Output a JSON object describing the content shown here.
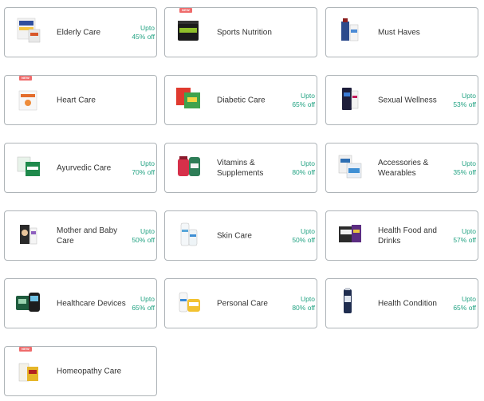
{
  "categories": [
    {
      "name": "Elderly Care",
      "discount": [
        "Upto",
        "45% off"
      ]
    },
    {
      "name": "Sports Nutrition",
      "discount": null,
      "new_badge": "NEW"
    },
    {
      "name": "Must Haves",
      "discount": null
    },
    {
      "name": "Heart Care",
      "discount": null,
      "new_badge": "NEW"
    },
    {
      "name": "Diabetic Care",
      "discount": [
        "Upto",
        "65% off"
      ]
    },
    {
      "name": "Sexual Wellness",
      "discount": [
        "Upto",
        "53% off"
      ]
    },
    {
      "name": "Ayurvedic Care",
      "discount": [
        "Upto",
        "70% off"
      ]
    },
    {
      "name": "Vitamins & Supplements",
      "discount": [
        "Upto",
        "80% off"
      ]
    },
    {
      "name": "Accessories & Wearables",
      "discount": [
        "Upto",
        "35% off"
      ]
    },
    {
      "name": "Mother and Baby Care",
      "discount": [
        "Upto",
        "50% off"
      ]
    },
    {
      "name": "Skin Care",
      "discount": [
        "Upto",
        "50% off"
      ]
    },
    {
      "name": "Health Food and Drinks",
      "discount": [
        "Upto",
        "57% off"
      ]
    },
    {
      "name": "Healthcare Devices",
      "discount": [
        "Upto",
        "65% off"
      ]
    },
    {
      "name": "Personal Care",
      "discount": [
        "Upto",
        "80% off"
      ]
    },
    {
      "name": "Health Condition",
      "discount": [
        "Upto",
        "65% off"
      ]
    },
    {
      "name": "Homeopathy Care",
      "discount": null,
      "new_badge": "NEW"
    }
  ],
  "colors": {
    "discount_text": "#23a383",
    "card_border": "#aeb4b8",
    "new_badge": "#ef6b6b"
  },
  "icons": [
    "elderly-care-product-icon",
    "sports-nutrition-product-icon",
    "must-haves-product-icon",
    "heart-care-product-icon",
    "diabetic-care-product-icon",
    "sexual-wellness-product-icon",
    "ayurvedic-care-product-icon",
    "vitamins-supplements-product-icon",
    "accessories-wearables-product-icon",
    "mother-baby-care-product-icon",
    "skin-care-product-icon",
    "health-food-drinks-product-icon",
    "healthcare-devices-product-icon",
    "personal-care-product-icon",
    "health-condition-product-icon",
    "homeopathy-care-product-icon"
  ]
}
